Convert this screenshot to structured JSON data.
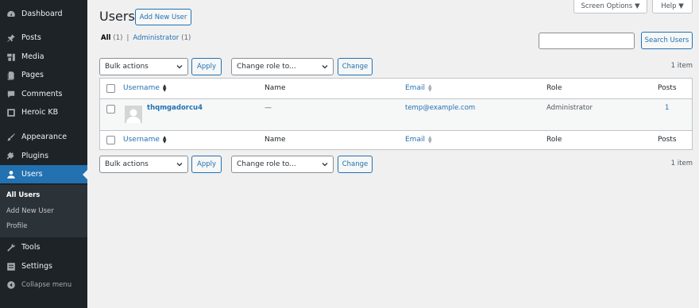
{
  "sidebar": {
    "items": [
      {
        "label": "Dashboard",
        "icon": "dashboard-icon"
      },
      {
        "label": "Posts",
        "icon": "pushpin-icon"
      },
      {
        "label": "Media",
        "icon": "media-icon"
      },
      {
        "label": "Pages",
        "icon": "pages-icon"
      },
      {
        "label": "Comments",
        "icon": "comments-icon"
      },
      {
        "label": "Heroic KB",
        "icon": "heroic-kb-icon"
      },
      {
        "label": "Appearance",
        "icon": "brush-icon"
      },
      {
        "label": "Plugins",
        "icon": "plugin-icon"
      },
      {
        "label": "Users",
        "icon": "users-icon"
      },
      {
        "label": "Tools",
        "icon": "wrench-icon"
      },
      {
        "label": "Settings",
        "icon": "settings-icon"
      }
    ],
    "submenu": [
      "All Users",
      "Add New User",
      "Profile"
    ],
    "collapse_label": "Collapse menu"
  },
  "top": {
    "screen_options": "Screen Options ▼",
    "help": "Help ▼"
  },
  "header": {
    "title": "Users",
    "add_new": "Add New User"
  },
  "filters": {
    "all": "All",
    "all_count": "(1)",
    "separator": "|",
    "admin": "Administrator",
    "admin_count": "(1)"
  },
  "search": {
    "button": "Search Users",
    "value": ""
  },
  "tablenav": {
    "bulk_actions": "Bulk actions",
    "apply": "Apply",
    "change_role": "Change role to...",
    "change": "Change",
    "count": "1 item"
  },
  "table": {
    "columns": {
      "username": "Username",
      "name": "Name",
      "email": "Email",
      "role": "Role",
      "posts": "Posts"
    },
    "rows": [
      {
        "username": "thqmgadorcu4",
        "name": "—",
        "email": "temp@example.com",
        "role": "Administrator",
        "posts": "1"
      }
    ]
  },
  "colors": {
    "sidebar_bg": "#1d2327",
    "accent": "#2271b1",
    "page_bg": "#f0f0f1"
  }
}
